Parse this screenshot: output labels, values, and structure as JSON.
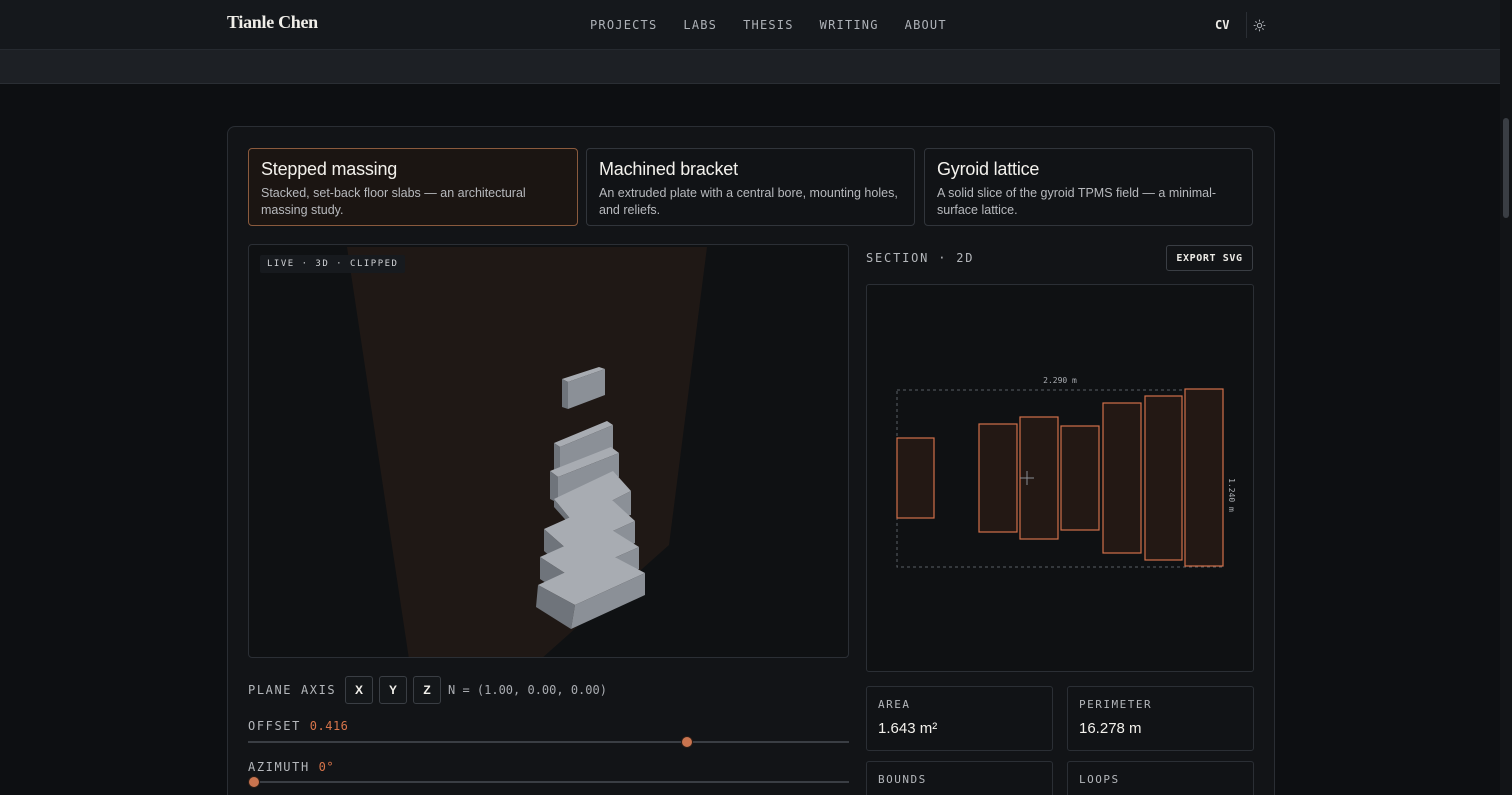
{
  "header": {
    "brand": "Tianle Chen",
    "nav": [
      "PROJECTS",
      "LABS",
      "THESIS",
      "WRITING",
      "ABOUT"
    ],
    "cv_label": "CV",
    "theme_icon": "sun-icon"
  },
  "presets": [
    {
      "title": "Stepped massing",
      "desc": "Stacked, set-back floor slabs — an architectural massing study."
    },
    {
      "title": "Machined bracket",
      "desc": "An extruded plate with a central bore, mounting holes, and reliefs."
    },
    {
      "title": "Gyroid lattice",
      "desc": "A solid slice of the gyroid TPMS field — a minimal-surface lattice."
    }
  ],
  "viewport": {
    "badge": "LIVE · 3D · CLIPPED"
  },
  "section": {
    "title": "SECTION · 2D",
    "export_label": "EXPORT SVG",
    "width_label": "2.290 m",
    "height_label": "1.240 m"
  },
  "controls": {
    "plane_axis_label": "PLANE AXIS",
    "axes": [
      "X",
      "Y",
      "Z"
    ],
    "normal": "N = (1.00, 0.00, 0.00)",
    "offset_label": "OFFSET",
    "offset_value": "0.416",
    "offset_fraction": 0.735,
    "azimuth_label": "AZIMUTH",
    "azimuth_value": "0°",
    "azimuth_fraction": 0.0
  },
  "stats": {
    "area_label": "AREA",
    "area_value": "1.643 m²",
    "perimeter_label": "PERIMETER",
    "perimeter_value": "16.278 m",
    "bounds_label": "BOUNDS",
    "loops_label": "LOOPS"
  },
  "colors": {
    "accent": "#d7744a",
    "background": "#0d0f12",
    "section_stroke": "#d0704a"
  }
}
